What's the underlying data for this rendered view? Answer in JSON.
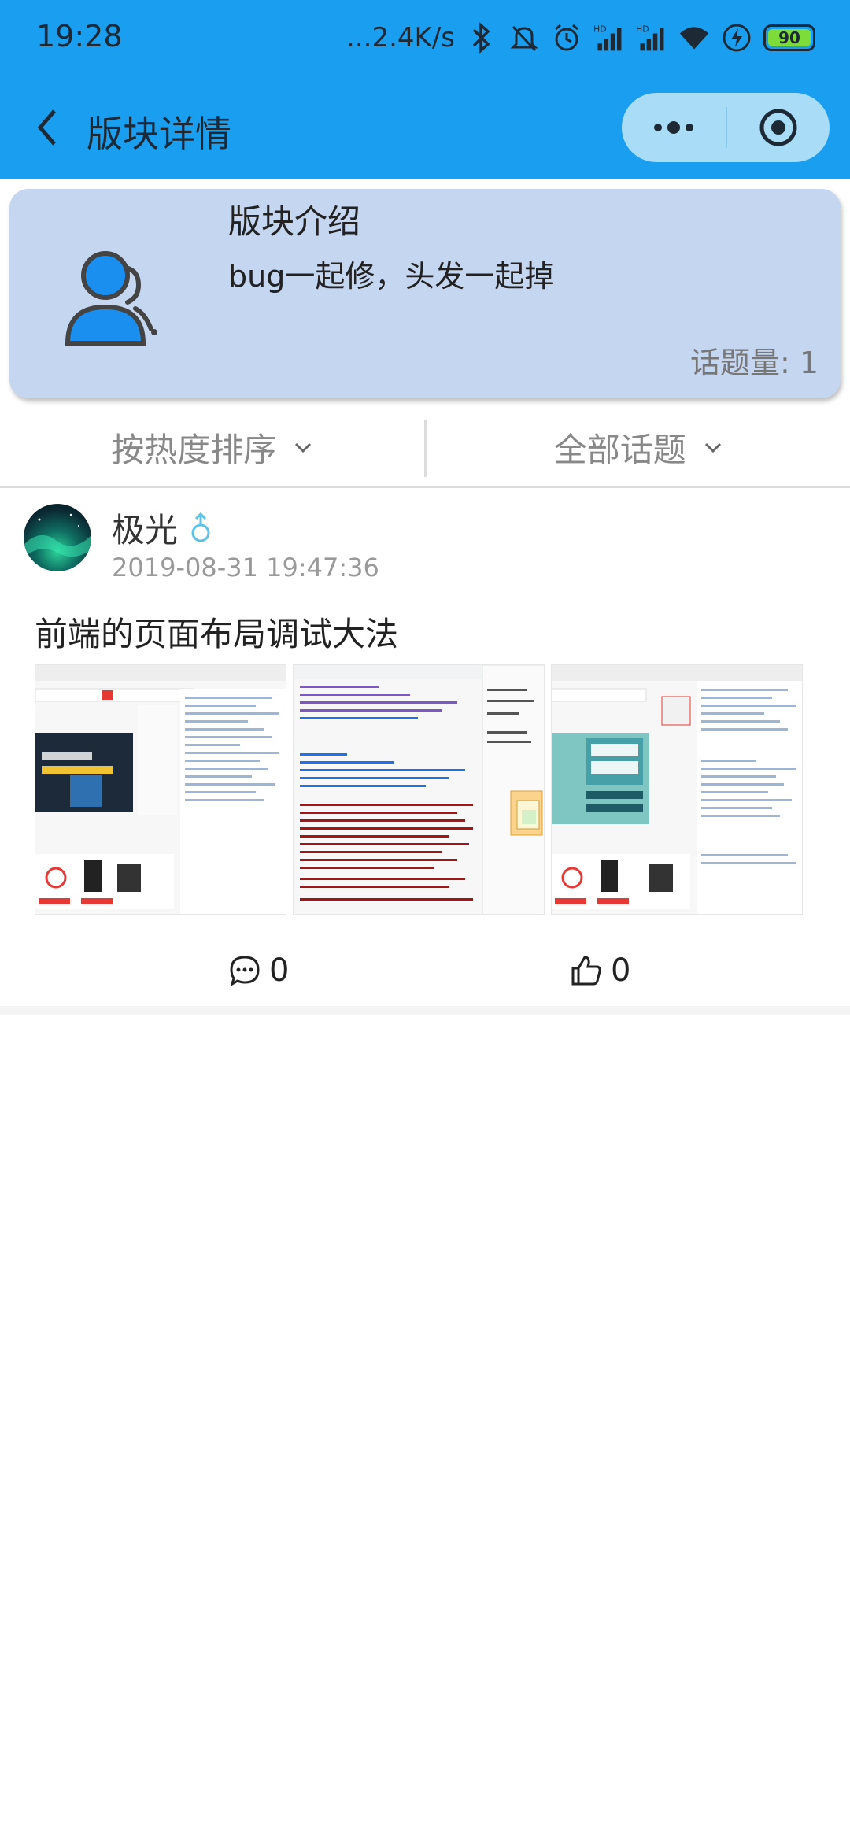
{
  "status_bar": {
    "time": "19:28",
    "net_speed": "...2.4K/s",
    "battery": "90",
    "icons": [
      "bluetooth-icon",
      "mute-icon",
      "alarm-icon",
      "signal-icon",
      "signal-icon",
      "wifi-icon",
      "charging-icon",
      "battery-icon"
    ],
    "hd": "HD"
  },
  "title_bar": {
    "title": "版块详情",
    "back_icon": "chevron-left-icon",
    "more_icon": "more-dots-icon",
    "close_icon": "target-close-icon"
  },
  "intro": {
    "title": "版块介绍",
    "description": "bug一起修，头发一起掉",
    "topic_count": "话题量: 1",
    "avatar_icon": "group-users-icon"
  },
  "filters": {
    "sort_label": "按热度排序",
    "topic_label": "全部话题"
  },
  "post": {
    "username": "极光",
    "gender_icon": "male-icon",
    "time": "2019-08-31 19:47:36",
    "title": "前端的页面布局调试大法",
    "images": [
      "screenshot-thumbnail-1",
      "screenshot-thumbnail-2",
      "screenshot-thumbnail-3"
    ],
    "comment_count": "0",
    "like_count": "0"
  },
  "colors": {
    "header_bg": "#1a9ff0",
    "card_bg": "#c5d6f1",
    "avatar_blue": "#1a8ff0"
  }
}
